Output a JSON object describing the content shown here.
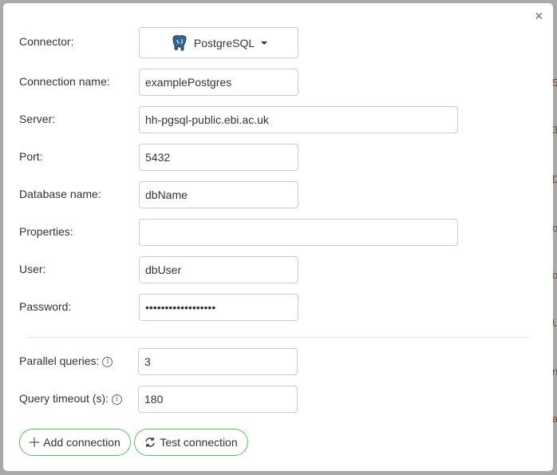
{
  "background_fragments": [
    "5",
    "3",
    "D",
    "o",
    "ol",
    "U",
    "n",
    "a"
  ],
  "dialog": {
    "close_label": "×"
  },
  "connector": {
    "label": "Connector:",
    "value": "PostgreSQL",
    "icon": "postgresql-elephant-icon"
  },
  "fields": [
    {
      "label": "Connection name:",
      "value": "examplePostgres"
    },
    {
      "label": "Server:",
      "value": "hh-pgsql-public.ebi.ac.uk"
    },
    {
      "label": "Port:",
      "value": "5432"
    },
    {
      "label": "Database name:",
      "value": "dbName"
    },
    {
      "label": "Properties:",
      "value": ""
    },
    {
      "label": "User:",
      "value": "dbUser"
    },
    {
      "label": "Password:",
      "value": "••••••••••••••••••"
    }
  ],
  "advanced": [
    {
      "label": "Parallel queries:",
      "value": "3"
    },
    {
      "label": "Query timeout (s):",
      "value": "180"
    }
  ],
  "buttons": {
    "add": "Add connection",
    "test": "Test connection"
  },
  "colors": {
    "button_border": "#5cb85c",
    "overlay": "#a9a9a9"
  }
}
